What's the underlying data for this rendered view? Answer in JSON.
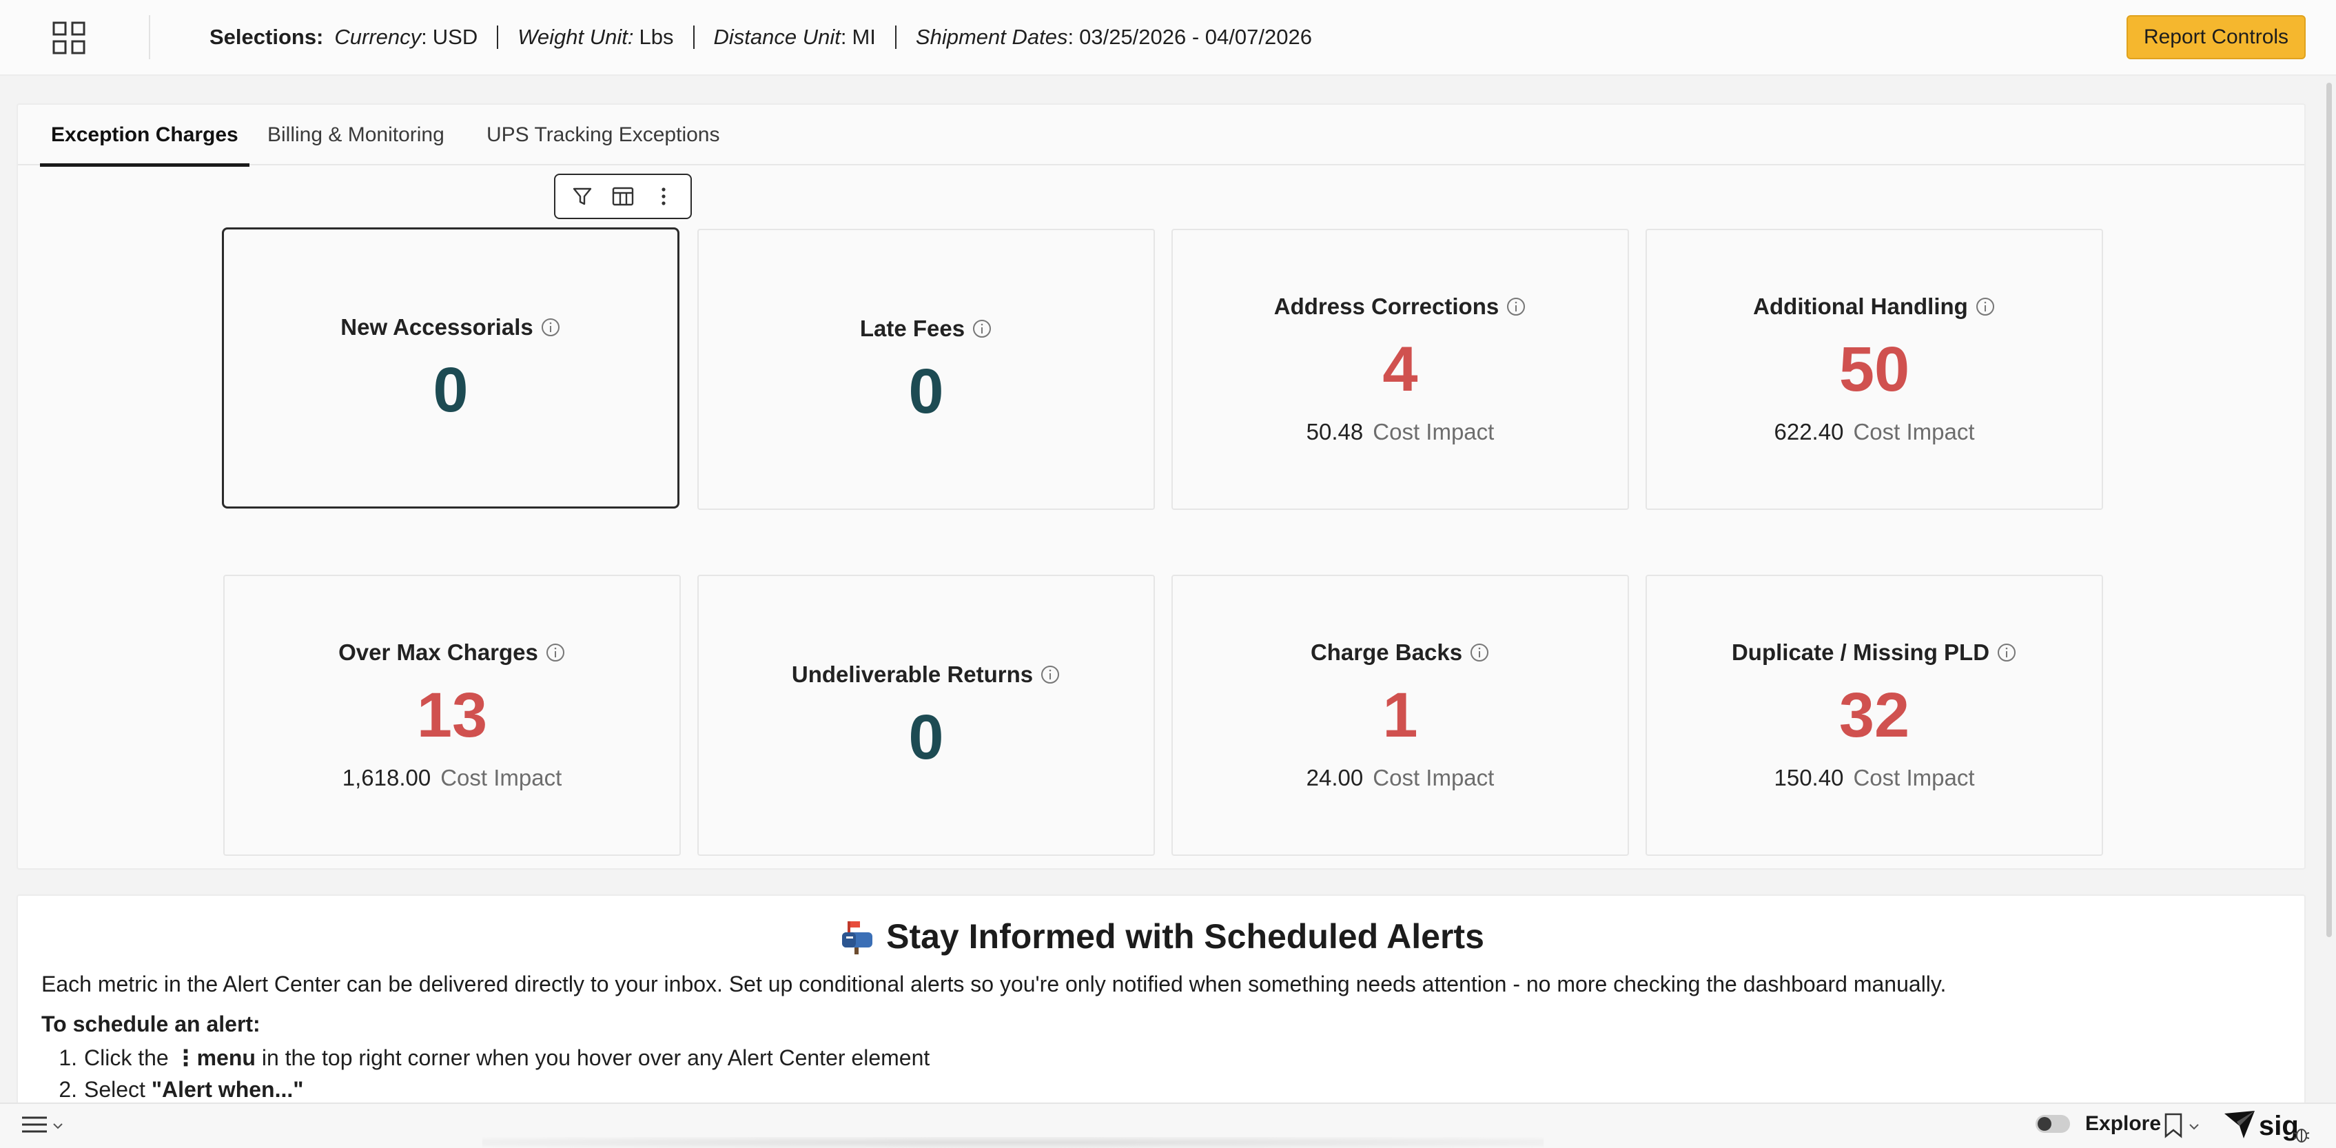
{
  "header": {
    "selections_label": "Selections:",
    "filters": [
      {
        "key": "Currency",
        "value": "USD"
      },
      {
        "key": "Weight Unit:",
        "value": "Lbs"
      },
      {
        "key": "Distance Unit",
        "value": "MI"
      },
      {
        "key": "Shipment Dates",
        "value": "03/25/2026 - 04/07/2026"
      }
    ],
    "report_controls_label": "Report Controls"
  },
  "tabs": [
    {
      "label": "Exception Charges",
      "active": true
    },
    {
      "label": "Billing & Monitoring",
      "active": false
    },
    {
      "label": "UPS Tracking Exceptions",
      "active": false
    }
  ],
  "cards": [
    {
      "title": "New Accessorials",
      "value": "0"
    },
    {
      "title": "Late Fees",
      "value": "0"
    },
    {
      "title": "Address Corrections",
      "value": "4",
      "cost": "50.48",
      "cost_label": "Cost Impact"
    },
    {
      "title": "Additional Handling",
      "value": "50",
      "cost": "622.40",
      "cost_label": "Cost Impact"
    },
    {
      "title": "Over Max Charges",
      "value": "13",
      "cost": "1,618.00",
      "cost_label": "Cost Impact"
    },
    {
      "title": "Undeliverable Returns",
      "value": "0"
    },
    {
      "title": "Charge Backs",
      "value": "1",
      "cost": "24.00",
      "cost_label": "Cost Impact"
    },
    {
      "title": "Duplicate / Missing PLD",
      "value": "32",
      "cost": "150.40",
      "cost_label": "Cost Impact"
    }
  ],
  "alert": {
    "title": "Stay Informed with Scheduled Alerts",
    "description": "Each metric in the Alert Center can be delivered directly to your inbox. Set up conditional alerts so you're only notified when something needs attention - no more checking the dashboard manually.",
    "steps_title": "To schedule an alert:",
    "step1_pre": "Click the ",
    "step1_bold": "⋮menu",
    "step1_post": " in the top right corner when you hover over any Alert Center element",
    "step2_pre": "Select ",
    "step2_bold": "\"Alert when...\""
  },
  "bottom": {
    "explore_label": "Explore",
    "brand_text": "sig"
  },
  "colors": {
    "accent": "#f5b72e",
    "value_teal": "#1d4b53",
    "value_red": "#d0514f"
  }
}
